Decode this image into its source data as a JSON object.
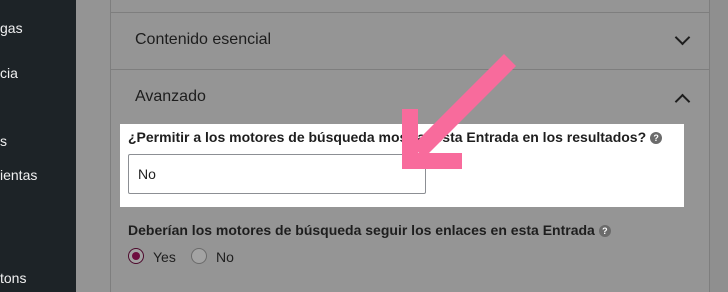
{
  "sidebar": {
    "items": [
      {
        "label": "gas"
      },
      {
        "label": "cia"
      },
      {
        "label": "s"
      },
      {
        "label": "ientas"
      },
      {
        "label": "tons"
      }
    ]
  },
  "sections": {
    "essential": {
      "title": "Contenido esencial"
    },
    "advanced": {
      "title": "Avanzado"
    }
  },
  "advanced": {
    "allow_index": {
      "label": "¿Permitir a los motores de búsqueda mostrar esta Entrada en los resultados?",
      "value": "No"
    },
    "follow_links": {
      "label": "Deberían los motores de búsqueda seguir los enlaces en esta Entrada",
      "options": [
        "Yes",
        "No"
      ],
      "selected": "Yes"
    }
  },
  "colors": {
    "arrow": "#f86b9c",
    "radio_accent": "#6e0f40"
  },
  "icons": [
    "question-circle-icon",
    "chevron-down-icon",
    "chevron-up-icon",
    "pointer-arrow-icon"
  ]
}
